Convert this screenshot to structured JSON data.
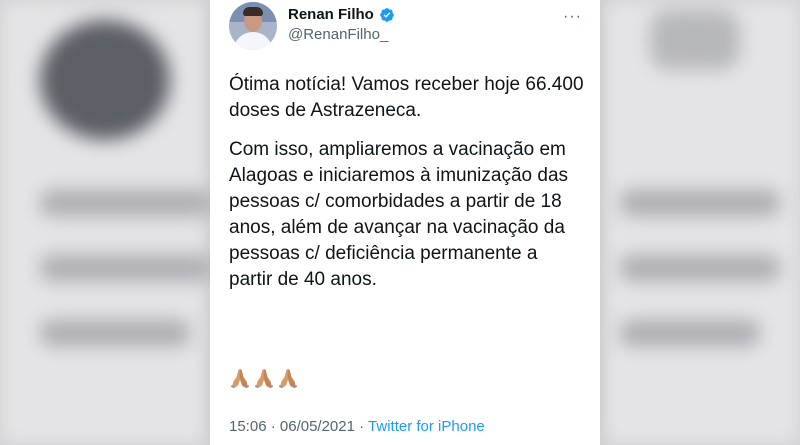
{
  "tweet": {
    "author_name": "Renan Filho",
    "handle": "@RenanFilho_",
    "more_label": "···",
    "paragraphs": [
      "Ótima notícia! Vamos receber hoje 66.400 doses de Astrazeneca.",
      "Com isso, ampliaremos a vacinação em Alagoas e iniciaremos à imunização das pessoas c/ comorbidades a partir de 18 anos, além de avançar na vacinação da pessoas c/ deficiência permanente a partir de 40 anos."
    ],
    "emojis": [
      "folded-hands",
      "folded-hands",
      "folded-hands"
    ],
    "time": "15:06",
    "date": "06/05/2021",
    "separator": "·",
    "source": "Twitter for iPhone"
  },
  "colors": {
    "verified": "#1d9bf0",
    "link": "#1d9bf0",
    "secondary_text": "#536471",
    "primary_text": "#0f1419"
  }
}
